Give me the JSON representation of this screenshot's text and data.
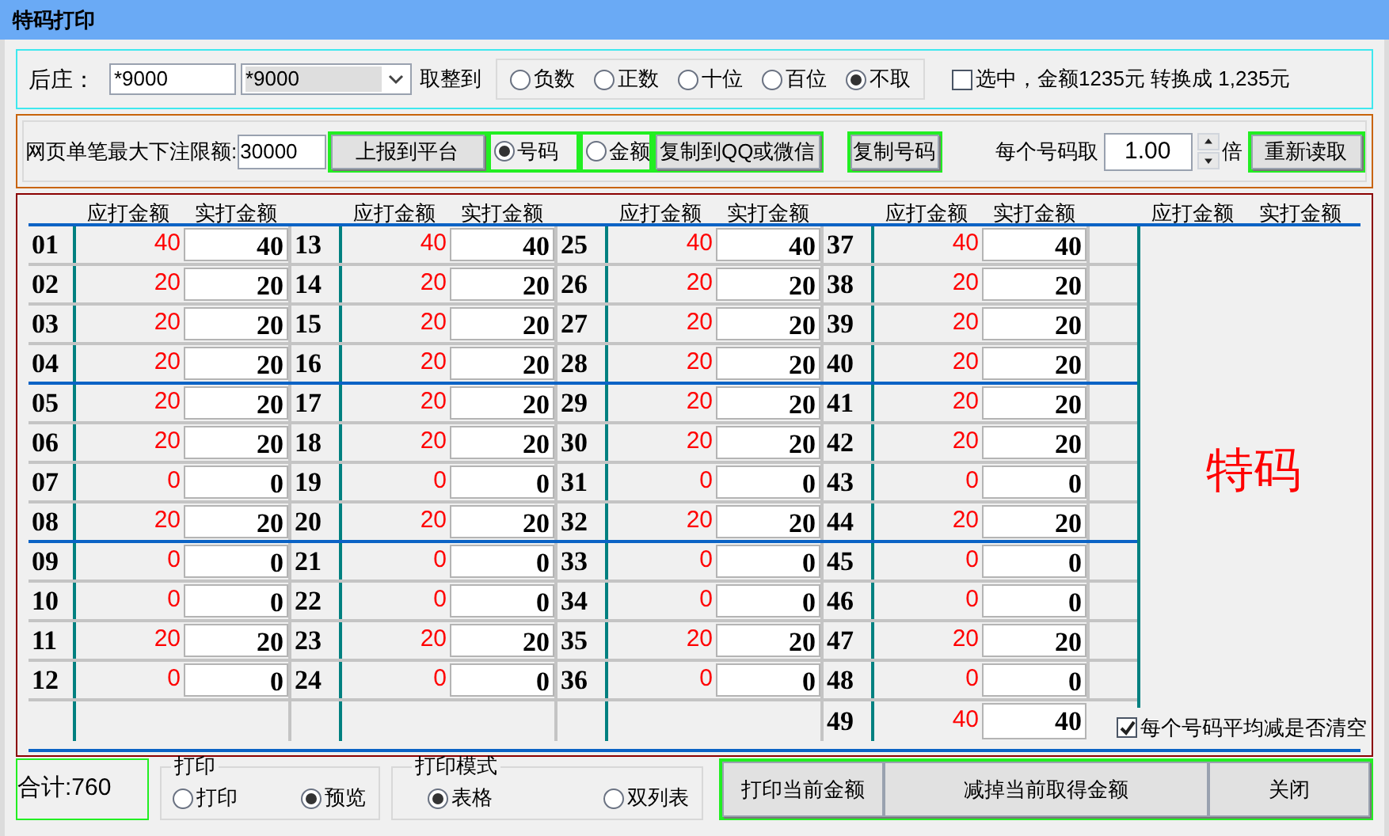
{
  "window": {
    "title": "特码打印"
  },
  "banker": {
    "label": "后庄：",
    "value": "*9000",
    "select_value": "*9000",
    "round_label": "取整到",
    "round_options": [
      {
        "label": "负数",
        "selected": false
      },
      {
        "label": "正数",
        "selected": false
      },
      {
        "label": "十位",
        "selected": false
      },
      {
        "label": "百位",
        "selected": false
      },
      {
        "label": "不取",
        "selected": true
      }
    ],
    "convert": {
      "label": "选中，金额1235元 转换成 1,235元",
      "checked": false
    }
  },
  "limit_bar": {
    "label": "网页单笔最大下注限额:",
    "value": "30000",
    "report_button": "上报到平台",
    "modes": [
      {
        "label": "号码",
        "selected": true
      },
      {
        "label": "金额",
        "selected": false
      }
    ],
    "copy_qq_button": "复制到QQ或微信",
    "copy_numbers_button": "复制号码",
    "multiplier_label": "每个号码取",
    "multiplier": "1.00",
    "times_label": "倍",
    "reload_button": "重新读取"
  },
  "grid": {
    "headers": [
      "应打金额",
      "实打金额",
      "应打金额",
      "实打金额",
      "应打金额",
      "实打金额",
      "应打金额",
      "实打金额",
      "应打金额",
      "实打金额"
    ],
    "columns": [
      [
        {
          "number": "01",
          "due": "40",
          "actual": "40"
        },
        {
          "number": "02",
          "due": "20",
          "actual": "20"
        },
        {
          "number": "03",
          "due": "20",
          "actual": "20"
        },
        {
          "number": "04",
          "due": "20",
          "actual": "20"
        },
        {
          "number": "05",
          "due": "20",
          "actual": "20"
        },
        {
          "number": "06",
          "due": "20",
          "actual": "20"
        },
        {
          "number": "07",
          "due": "0",
          "actual": "0"
        },
        {
          "number": "08",
          "due": "20",
          "actual": "20"
        },
        {
          "number": "09",
          "due": "0",
          "actual": "0"
        },
        {
          "number": "10",
          "due": "0",
          "actual": "0"
        },
        {
          "number": "11",
          "due": "20",
          "actual": "20"
        },
        {
          "number": "12",
          "due": "0",
          "actual": "0"
        }
      ],
      [
        {
          "number": "13",
          "due": "40",
          "actual": "40"
        },
        {
          "number": "14",
          "due": "20",
          "actual": "20"
        },
        {
          "number": "15",
          "due": "20",
          "actual": "20"
        },
        {
          "number": "16",
          "due": "20",
          "actual": "20"
        },
        {
          "number": "17",
          "due": "20",
          "actual": "20"
        },
        {
          "number": "18",
          "due": "20",
          "actual": "20"
        },
        {
          "number": "19",
          "due": "0",
          "actual": "0"
        },
        {
          "number": "20",
          "due": "20",
          "actual": "20"
        },
        {
          "number": "21",
          "due": "0",
          "actual": "0"
        },
        {
          "number": "22",
          "due": "0",
          "actual": "0"
        },
        {
          "number": "23",
          "due": "20",
          "actual": "20"
        },
        {
          "number": "24",
          "due": "0",
          "actual": "0"
        }
      ],
      [
        {
          "number": "25",
          "due": "40",
          "actual": "40"
        },
        {
          "number": "26",
          "due": "20",
          "actual": "20"
        },
        {
          "number": "27",
          "due": "20",
          "actual": "20"
        },
        {
          "number": "28",
          "due": "20",
          "actual": "20"
        },
        {
          "number": "29",
          "due": "20",
          "actual": "20"
        },
        {
          "number": "30",
          "due": "20",
          "actual": "20"
        },
        {
          "number": "31",
          "due": "0",
          "actual": "0"
        },
        {
          "number": "32",
          "due": "20",
          "actual": "20"
        },
        {
          "number": "33",
          "due": "0",
          "actual": "0"
        },
        {
          "number": "34",
          "due": "0",
          "actual": "0"
        },
        {
          "number": "35",
          "due": "20",
          "actual": "20"
        },
        {
          "number": "36",
          "due": "0",
          "actual": "0"
        }
      ],
      [
        {
          "number": "37",
          "due": "40",
          "actual": "40"
        },
        {
          "number": "38",
          "due": "20",
          "actual": "20"
        },
        {
          "number": "39",
          "due": "20",
          "actual": "20"
        },
        {
          "number": "40",
          "due": "20",
          "actual": "20"
        },
        {
          "number": "41",
          "due": "20",
          "actual": "20"
        },
        {
          "number": "42",
          "due": "20",
          "actual": "20"
        },
        {
          "number": "43",
          "due": "0",
          "actual": "0"
        },
        {
          "number": "44",
          "due": "20",
          "actual": "20"
        },
        {
          "number": "45",
          "due": "0",
          "actual": "0"
        },
        {
          "number": "46",
          "due": "0",
          "actual": "0"
        },
        {
          "number": "47",
          "due": "20",
          "actual": "20"
        },
        {
          "number": "48",
          "due": "0",
          "actual": "0"
        },
        {
          "number": "49",
          "due": "40",
          "actual": "40"
        }
      ]
    ],
    "big_label": "特码",
    "clear_option": {
      "label": "每个号码平均减是否清空",
      "checked": true
    }
  },
  "footer": {
    "total": "合计:760",
    "print": {
      "title": "打印",
      "options": [
        {
          "label": "打印",
          "selected": false
        },
        {
          "label": "预览",
          "selected": true
        }
      ]
    },
    "print_mode": {
      "title": "打印模式",
      "options": [
        {
          "label": "表格",
          "selected": true
        },
        {
          "label": "双列表",
          "selected": false
        }
      ]
    },
    "buttons": [
      "打印当前金额",
      "减掉当前取得金额",
      "关闭"
    ]
  }
}
